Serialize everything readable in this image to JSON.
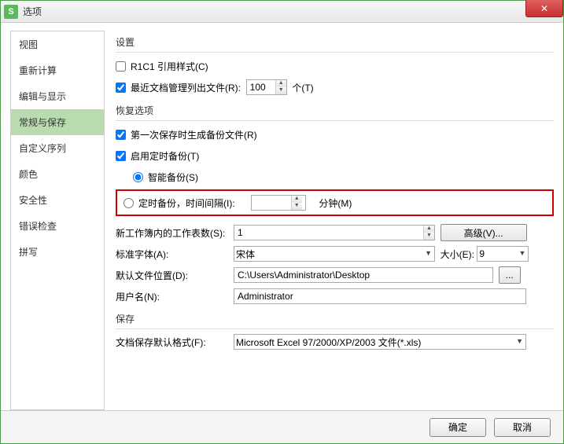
{
  "window": {
    "title": "选项"
  },
  "sidebar": {
    "items": [
      {
        "label": "视图"
      },
      {
        "label": "重新计算"
      },
      {
        "label": "编辑与显示"
      },
      {
        "label": "常规与保存"
      },
      {
        "label": "自定义序列"
      },
      {
        "label": "颜色"
      },
      {
        "label": "安全性"
      },
      {
        "label": "错误检查"
      },
      {
        "label": "拼写"
      }
    ],
    "active_index": 3
  },
  "settings": {
    "group_label": "设置",
    "r1c1_label": "R1C1 引用样式(C)",
    "r1c1_checked": false,
    "recent_label": "最近文档管理列出文件(R):",
    "recent_checked": true,
    "recent_value": "100",
    "recent_unit": "个(T)"
  },
  "recovery": {
    "group_label": "恢复选项",
    "first_save_label": "第一次保存时生成备份文件(R)",
    "first_save_checked": true,
    "timed_backup_label": "启用定时备份(T)",
    "timed_backup_checked": true,
    "smart_label": "智能备份(S)",
    "smart_selected": true,
    "interval_label": "定时备份，时间间隔(I):",
    "interval_value": "",
    "interval_unit": "分钟(M)",
    "interval_selected": false
  },
  "workbook": {
    "sheets_label": "新工作簿内的工作表数(S):",
    "sheets_value": "1",
    "advanced_label": "高级(V)...",
    "font_label": "标准字体(A):",
    "font_value": "宋体",
    "size_label": "大小(E):",
    "size_value": "9",
    "default_path_label": "默认文件位置(D):",
    "default_path_value": "C:\\Users\\Administrator\\Desktop",
    "browse_label": "...",
    "username_label": "用户名(N):",
    "username_value": "Administrator"
  },
  "save": {
    "group_label": "保存",
    "format_label": "文档保存默认格式(F):",
    "format_value": "Microsoft Excel 97/2000/XP/2003 文件(*.xls)"
  },
  "footer": {
    "ok": "确定",
    "cancel": "取消"
  }
}
